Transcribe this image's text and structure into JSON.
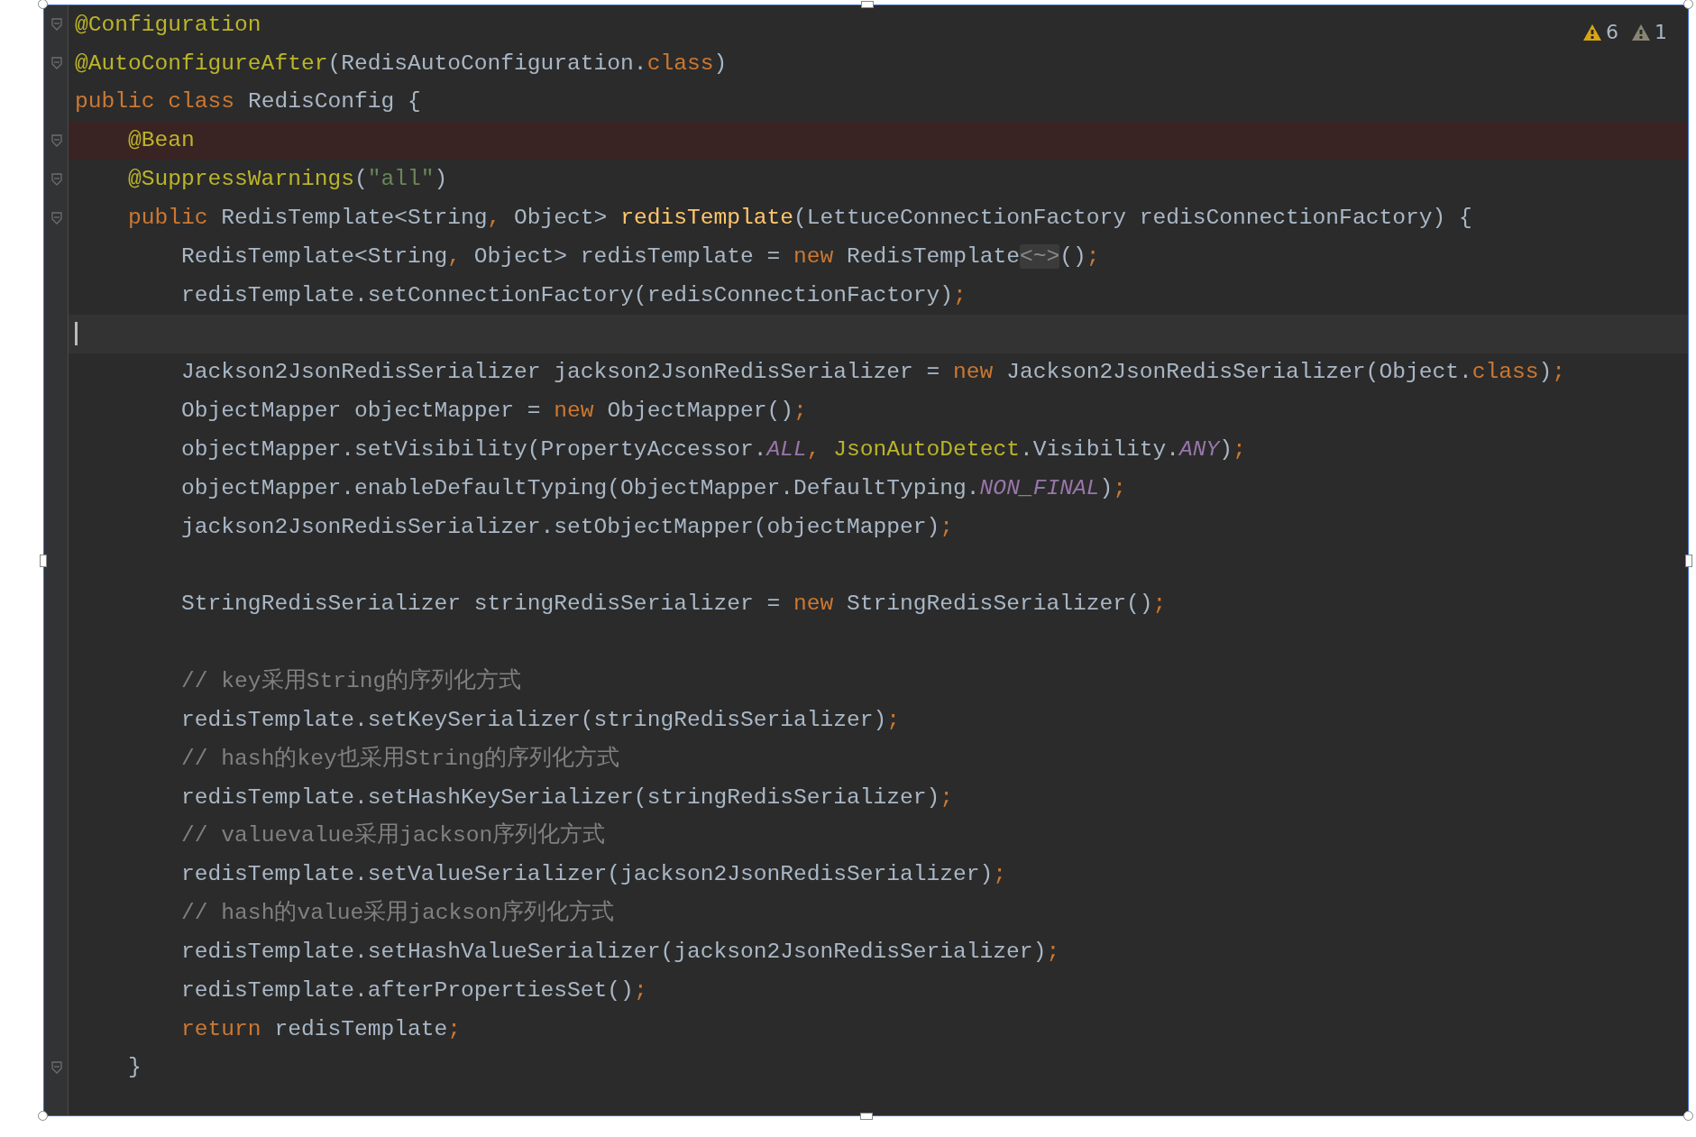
{
  "editor": {
    "warnings": [
      {
        "count": "6",
        "color": "#d9a514"
      },
      {
        "count": "1",
        "color": "#8a8572"
      }
    ],
    "lines": [
      {
        "kind": "code",
        "fold": true,
        "breakpoint": false,
        "caret": false,
        "segs": [
          {
            "kind": "annotation",
            "text": "@Configuration"
          }
        ]
      },
      {
        "kind": "code",
        "fold": true,
        "breakpoint": false,
        "caret": false,
        "segs": [
          {
            "kind": "annotation",
            "text": "@AutoConfigureAfter"
          },
          {
            "kind": "plain",
            "text": "(RedisAutoConfiguration."
          },
          {
            "kind": "keyword",
            "text": "class"
          },
          {
            "kind": "plain",
            "text": ")"
          }
        ]
      },
      {
        "kind": "code",
        "fold": false,
        "breakpoint": false,
        "caret": false,
        "segs": [
          {
            "kind": "keyword",
            "text": "public class "
          },
          {
            "kind": "plain",
            "text": "RedisConfig {"
          }
        ],
        "children": [
          {
            "kind": "code",
            "fold": true,
            "breakpoint": true,
            "caret": false,
            "segs": [
              {
                "kind": "annotation",
                "text": "@Bean"
              }
            ]
          },
          {
            "kind": "code",
            "fold": true,
            "breakpoint": false,
            "caret": false,
            "segs": [
              {
                "kind": "annotation",
                "text": "@SuppressWarnings"
              },
              {
                "kind": "plain",
                "text": "("
              },
              {
                "kind": "string",
                "text": "\"all\""
              },
              {
                "kind": "plain",
                "text": ")"
              }
            ]
          },
          {
            "kind": "code",
            "fold": true,
            "breakpoint": false,
            "caret": false,
            "segs": [
              {
                "kind": "keyword",
                "text": "public "
              },
              {
                "kind": "plain",
                "text": "RedisTemplate<String"
              },
              {
                "kind": "keyword",
                "text": ", "
              },
              {
                "kind": "plain",
                "text": "Object> "
              },
              {
                "kind": "method",
                "text": "redisTemplate"
              },
              {
                "kind": "plain",
                "text": "(LettuceConnectionFactory redisConnectionFactory) {"
              }
            ],
            "children": [
              {
                "kind": "code",
                "fold": false,
                "breakpoint": false,
                "caret": false,
                "segs": [
                  {
                    "kind": "plain",
                    "text": "RedisTemplate<String"
                  },
                  {
                    "kind": "keyword",
                    "text": ", "
                  },
                  {
                    "kind": "plain",
                    "text": "Object> redisTemplate = "
                  },
                  {
                    "kind": "keyword",
                    "text": "new "
                  },
                  {
                    "kind": "plain",
                    "text": "RedisTemplate"
                  },
                  {
                    "kind": "folded",
                    "text": "<~>"
                  },
                  {
                    "kind": "plain",
                    "text": "()"
                  },
                  {
                    "kind": "keyword",
                    "text": ";"
                  }
                ]
              },
              {
                "kind": "code",
                "fold": false,
                "breakpoint": false,
                "caret": false,
                "segs": [
                  {
                    "kind": "plain",
                    "text": "redisTemplate.setConnectionFactory(redisConnectionFactory)"
                  },
                  {
                    "kind": "keyword",
                    "text": ";"
                  }
                ]
              },
              {
                "kind": "blank",
                "fold": false,
                "breakpoint": false,
                "caret": true
              },
              {
                "kind": "code",
                "fold": false,
                "breakpoint": false,
                "caret": false,
                "segs": [
                  {
                    "kind": "plain",
                    "text": "Jackson2JsonRedisSerializer jackson2JsonRedisSerializer = "
                  },
                  {
                    "kind": "keyword",
                    "text": "new "
                  },
                  {
                    "kind": "plain",
                    "text": "Jackson2JsonRedisSerializer(Object."
                  },
                  {
                    "kind": "keyword",
                    "text": "class"
                  },
                  {
                    "kind": "plain",
                    "text": ")"
                  },
                  {
                    "kind": "keyword",
                    "text": ";"
                  }
                ]
              },
              {
                "kind": "code",
                "fold": false,
                "breakpoint": false,
                "caret": false,
                "segs": [
                  {
                    "kind": "plain",
                    "text": "ObjectMapper objectMapper = "
                  },
                  {
                    "kind": "keyword",
                    "text": "new "
                  },
                  {
                    "kind": "plain",
                    "text": "ObjectMapper()"
                  },
                  {
                    "kind": "keyword",
                    "text": ";"
                  }
                ]
              },
              {
                "kind": "code",
                "fold": false,
                "breakpoint": false,
                "caret": false,
                "segs": [
                  {
                    "kind": "plain",
                    "text": "objectMapper.setVisibility(PropertyAccessor."
                  },
                  {
                    "kind": "constant",
                    "text": "ALL"
                  },
                  {
                    "kind": "keyword",
                    "text": ", "
                  },
                  {
                    "kind": "annotation",
                    "text": "JsonAutoDetect"
                  },
                  {
                    "kind": "plain",
                    "text": ".Visibility."
                  },
                  {
                    "kind": "constant",
                    "text": "ANY"
                  },
                  {
                    "kind": "plain",
                    "text": ")"
                  },
                  {
                    "kind": "keyword",
                    "text": ";"
                  }
                ]
              },
              {
                "kind": "code",
                "fold": false,
                "breakpoint": false,
                "caret": false,
                "segs": [
                  {
                    "kind": "plain",
                    "text": "objectMapper.enableDefaultTyping(ObjectMapper.DefaultTyping."
                  },
                  {
                    "kind": "constant",
                    "text": "NON_FINAL"
                  },
                  {
                    "kind": "plain",
                    "text": ")"
                  },
                  {
                    "kind": "keyword",
                    "text": ";"
                  }
                ]
              },
              {
                "kind": "code",
                "fold": false,
                "breakpoint": false,
                "caret": false,
                "segs": [
                  {
                    "kind": "plain",
                    "text": "jackson2JsonRedisSerializer.setObjectMapper(objectMapper)"
                  },
                  {
                    "kind": "keyword",
                    "text": ";"
                  }
                ]
              },
              {
                "kind": "blank",
                "fold": false,
                "breakpoint": false,
                "caret": false
              },
              {
                "kind": "code",
                "fold": false,
                "breakpoint": false,
                "caret": false,
                "segs": [
                  {
                    "kind": "plain",
                    "text": "StringRedisSerializer stringRedisSerializer = "
                  },
                  {
                    "kind": "keyword",
                    "text": "new "
                  },
                  {
                    "kind": "plain",
                    "text": "StringRedisSerializer()"
                  },
                  {
                    "kind": "keyword",
                    "text": ";"
                  }
                ]
              },
              {
                "kind": "blank",
                "fold": false,
                "breakpoint": false,
                "caret": false
              },
              {
                "kind": "code",
                "fold": false,
                "breakpoint": false,
                "caret": false,
                "segs": [
                  {
                    "kind": "comment",
                    "text": "// key采用String的序列化方式"
                  }
                ]
              },
              {
                "kind": "code",
                "fold": false,
                "breakpoint": false,
                "caret": false,
                "segs": [
                  {
                    "kind": "plain",
                    "text": "redisTemplate.setKeySerializer(stringRedisSerializer)"
                  },
                  {
                    "kind": "keyword",
                    "text": ";"
                  }
                ]
              },
              {
                "kind": "code",
                "fold": false,
                "breakpoint": false,
                "caret": false,
                "segs": [
                  {
                    "kind": "comment",
                    "text": "// hash的key也采用String的序列化方式"
                  }
                ]
              },
              {
                "kind": "code",
                "fold": false,
                "breakpoint": false,
                "caret": false,
                "segs": [
                  {
                    "kind": "plain",
                    "text": "redisTemplate.setHashKeySerializer(stringRedisSerializer)"
                  },
                  {
                    "kind": "keyword",
                    "text": ";"
                  }
                ]
              },
              {
                "kind": "code",
                "fold": false,
                "breakpoint": false,
                "caret": false,
                "segs": [
                  {
                    "kind": "comment",
                    "text": "// valuevalue采用jackson序列化方式"
                  }
                ]
              },
              {
                "kind": "code",
                "fold": false,
                "breakpoint": false,
                "caret": false,
                "segs": [
                  {
                    "kind": "plain",
                    "text": "redisTemplate.setValueSerializer(jackson2JsonRedisSerializer)"
                  },
                  {
                    "kind": "keyword",
                    "text": ";"
                  }
                ]
              },
              {
                "kind": "code",
                "fold": false,
                "breakpoint": false,
                "caret": false,
                "segs": [
                  {
                    "kind": "comment",
                    "text": "// hash的value采用jackson序列化方式"
                  }
                ]
              },
              {
                "kind": "code",
                "fold": false,
                "breakpoint": false,
                "caret": false,
                "segs": [
                  {
                    "kind": "plain",
                    "text": "redisTemplate.setHashValueSerializer(jackson2JsonRedisSerializer)"
                  },
                  {
                    "kind": "keyword",
                    "text": ";"
                  }
                ]
              },
              {
                "kind": "code",
                "fold": false,
                "breakpoint": false,
                "caret": false,
                "segs": [
                  {
                    "kind": "plain",
                    "text": "redisTemplate.afterPropertiesSet()"
                  },
                  {
                    "kind": "keyword",
                    "text": ";"
                  }
                ]
              },
              {
                "kind": "code",
                "fold": false,
                "breakpoint": false,
                "caret": false,
                "segs": [
                  {
                    "kind": "keyword",
                    "text": "return "
                  },
                  {
                    "kind": "plain",
                    "text": "redisTemplate"
                  },
                  {
                    "kind": "keyword",
                    "text": ";"
                  }
                ]
              }
            ]
          },
          {
            "kind": "code",
            "fold": true,
            "breakpoint": false,
            "caret": false,
            "segs": [
              {
                "kind": "plain",
                "text": "}"
              }
            ]
          }
        ]
      }
    ]
  }
}
